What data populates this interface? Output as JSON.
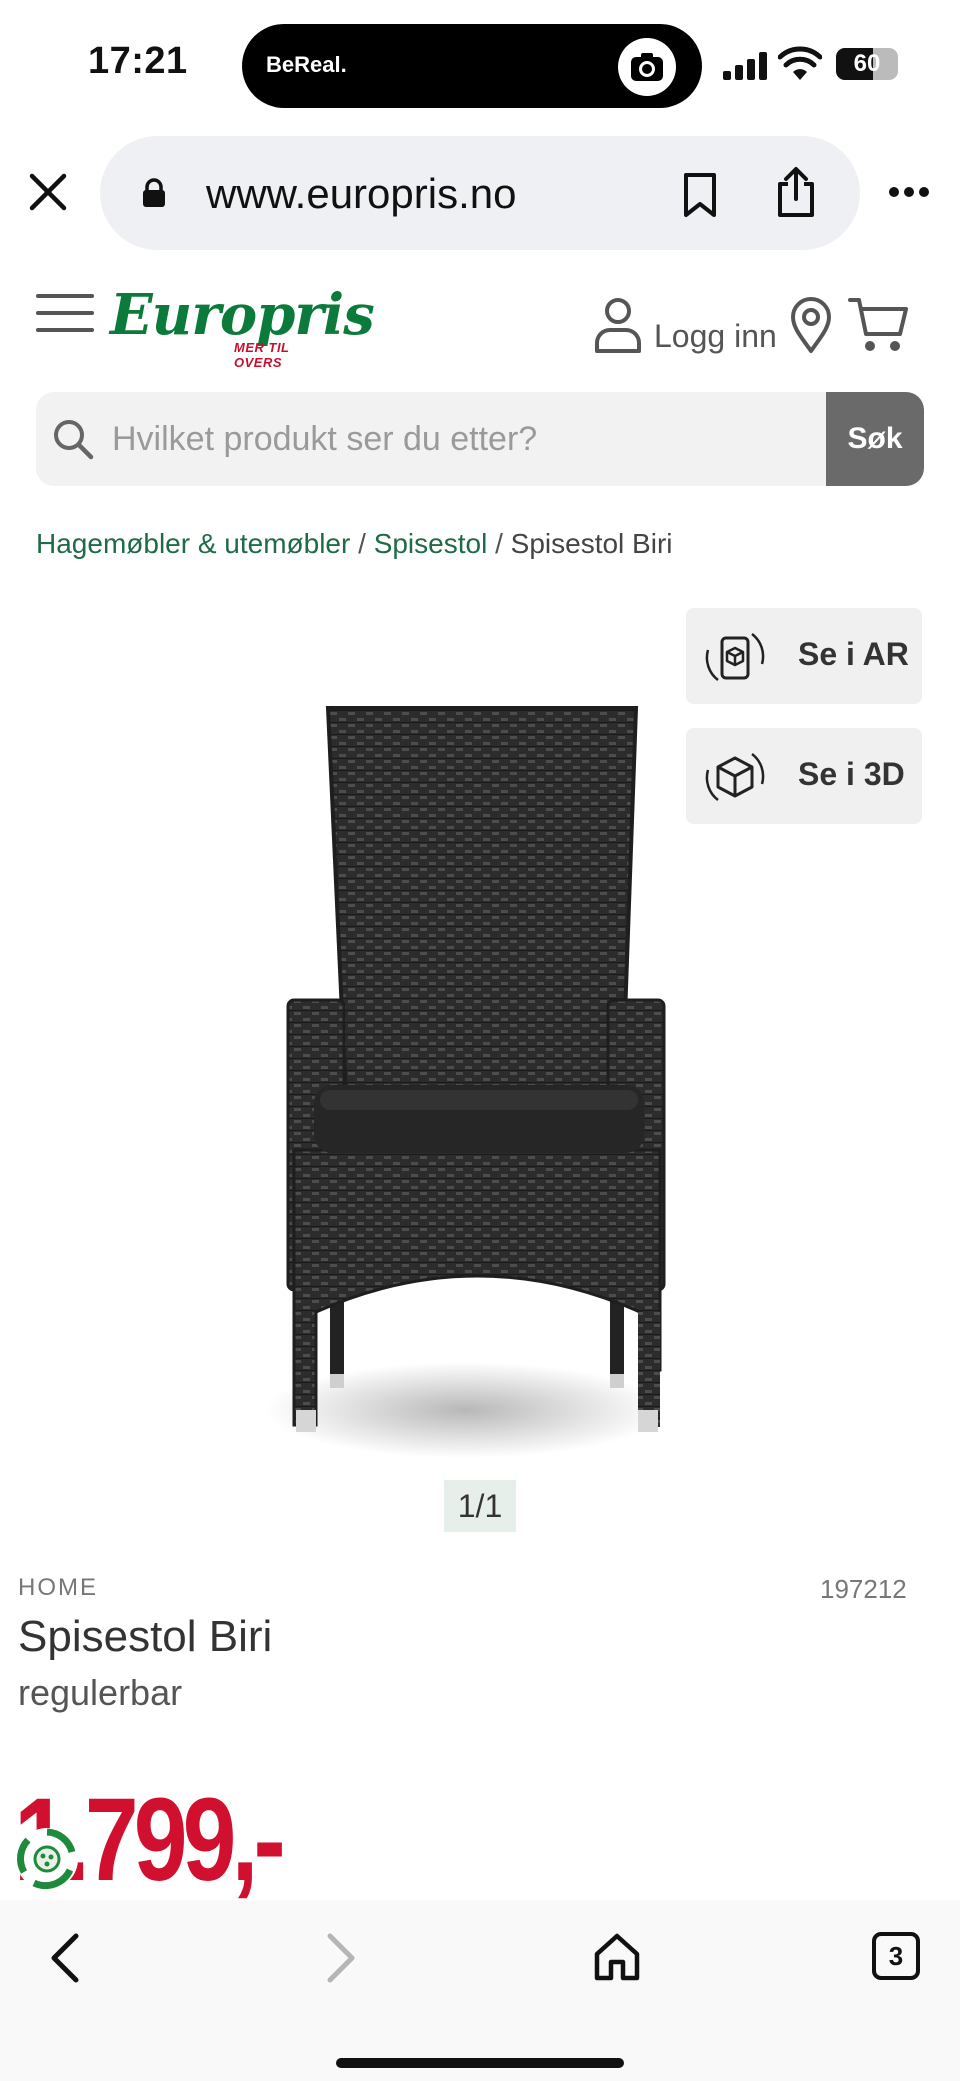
{
  "status_bar": {
    "time": "17:21",
    "island_label": "BeReal.",
    "battery": "60",
    "battery_level": 0.6
  },
  "browser": {
    "url": "www.europris.no",
    "open_tabs": "3"
  },
  "site_header": {
    "logo_text": "Europris",
    "logo_tagline": "MER TIL OVERS",
    "login_label": "Logg inn",
    "brand_color": "#0b7a3b",
    "accent_color": "#c8102e"
  },
  "search": {
    "placeholder": "Hvilket produkt ser du etter?",
    "button_label": "Søk"
  },
  "breadcrumb": {
    "items": [
      "Hagemøbler & utemøbler",
      "Spisestol",
      "Spisestol Biri"
    ],
    "separator": "/"
  },
  "viewer": {
    "ar_label": "Se i AR",
    "view3d_label": "Se i 3D",
    "image_counter": "1/1"
  },
  "product": {
    "brand": "HOME",
    "sku": "197212",
    "title": "Spisestol Biri",
    "subtitle": "regulerbar",
    "price": "1.799,-",
    "price_color": "#d0102e"
  },
  "icons": {
    "status": [
      "signal-icon",
      "wifi-icon",
      "battery-icon",
      "camera-icon"
    ],
    "browser": [
      "close-icon",
      "lock-icon",
      "bookmark-icon",
      "share-icon",
      "more-icon"
    ],
    "header": [
      "menu-icon",
      "user-icon",
      "location-pin-icon",
      "cart-icon",
      "search-icon"
    ],
    "nav": [
      "back-arrow-icon",
      "forward-arrow-icon",
      "home-icon",
      "tabs-icon"
    ]
  }
}
